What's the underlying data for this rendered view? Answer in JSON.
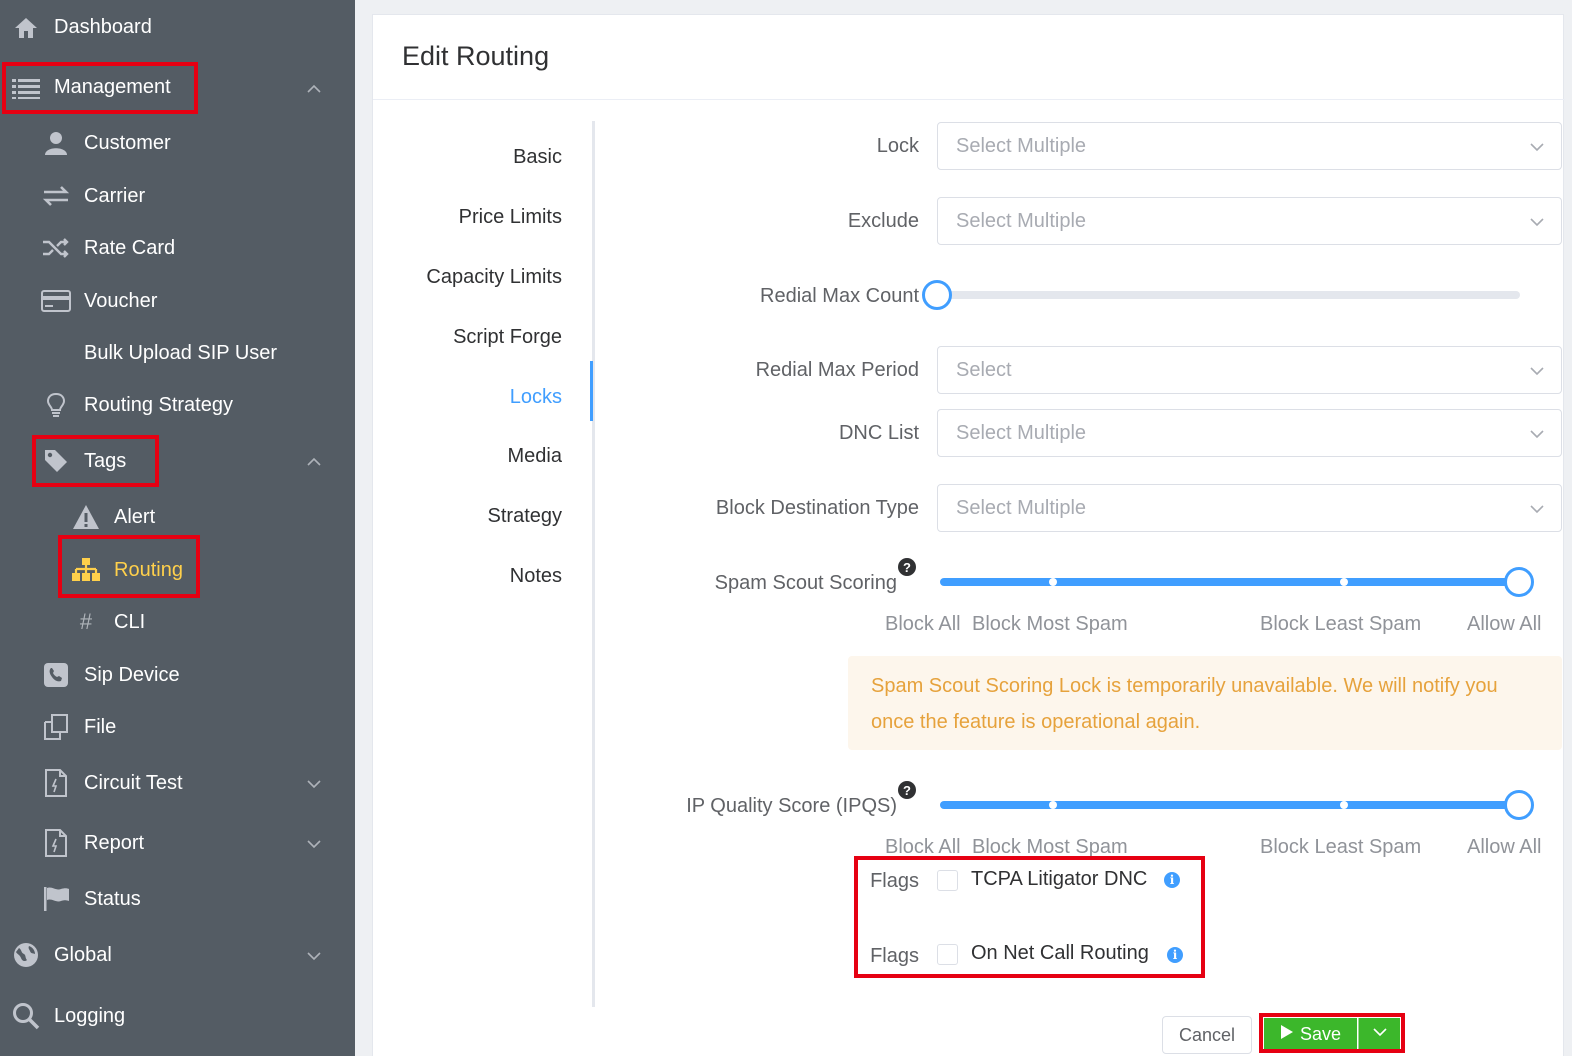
{
  "sidebar": {
    "items": [
      {
        "label": "Dashboard",
        "icon": "home-icon"
      },
      {
        "label": "Management",
        "icon": "list-icon",
        "expanded": true
      },
      {
        "label": "Customer",
        "icon": "user-icon"
      },
      {
        "label": "Carrier",
        "icon": "swap-icon"
      },
      {
        "label": "Rate Card",
        "icon": "shuffle-icon"
      },
      {
        "label": "Voucher",
        "icon": "card-icon"
      },
      {
        "label": "Bulk Upload SIP User",
        "icon": ""
      },
      {
        "label": "Routing Strategy",
        "icon": "bulb-icon"
      },
      {
        "label": "Tags",
        "icon": "tag-icon",
        "expanded": true
      },
      {
        "label": "Alert",
        "icon": "warning-icon"
      },
      {
        "label": "Routing",
        "icon": "sitemap-icon",
        "active": true
      },
      {
        "label": "CLI",
        "icon": "hash-icon"
      },
      {
        "label": "Sip Device",
        "icon": "phone-icon"
      },
      {
        "label": "File",
        "icon": "file-copy-icon"
      },
      {
        "label": "Circuit Test",
        "icon": "doc-icon"
      },
      {
        "label": "Report",
        "icon": "doc-icon"
      },
      {
        "label": "Status",
        "icon": "flag-icon"
      },
      {
        "label": "Global",
        "icon": "globe-icon"
      },
      {
        "label": "Logging",
        "icon": "search-icon"
      }
    ],
    "active_color": "#ffd04b",
    "background": "#545c64"
  },
  "page": {
    "title": "Edit Routing"
  },
  "tabs": [
    "Basic",
    "Price Limits",
    "Capacity Limits",
    "Script Forge",
    "Locks",
    "Media",
    "Strategy",
    "Notes"
  ],
  "active_tab": "Locks",
  "form": {
    "lock": {
      "label": "Lock",
      "placeholder": "Select Multiple"
    },
    "exclude": {
      "label": "Exclude",
      "placeholder": "Select Multiple"
    },
    "redial_max_count": {
      "label": "Redial Max Count",
      "value": 0
    },
    "redial_max_period": {
      "label": "Redial Max Period",
      "placeholder": "Select"
    },
    "dnc_list": {
      "label": "DNC List",
      "placeholder": "Select Multiple"
    },
    "block_destination_type": {
      "label": "Block Destination Type",
      "placeholder": "Select Multiple"
    },
    "spam_scout_scoring": {
      "label": "Spam Scout Scoring",
      "value_fraction": 1.0,
      "marks": [
        "Block All",
        "Block Most Spam",
        "Block Least Spam",
        "Allow All"
      ]
    },
    "spam_alert": {
      "line1": "Spam Scout Scoring Lock is temporarily unavailable. We will notify you",
      "line2": "once the feature is operational again."
    },
    "ipqs": {
      "label": "IP Quality Score (IPQS)",
      "value_fraction": 1.0,
      "marks": [
        "Block All",
        "Block Most Spam",
        "Block Least Spam",
        "Allow All"
      ]
    },
    "flags": [
      {
        "label": "Flags",
        "option": "TCPA Litigator DNC",
        "checked": false
      },
      {
        "label": "Flags",
        "option": "On Net Call Routing",
        "checked": false
      }
    ]
  },
  "actions": {
    "cancel": "Cancel",
    "save": "Save"
  },
  "colors": {
    "primary": "#409eff",
    "save": "#3cb72b",
    "highlight": "#e60012",
    "warning_text": "#e6a23c",
    "warning_bg": "#fdf6ec"
  }
}
